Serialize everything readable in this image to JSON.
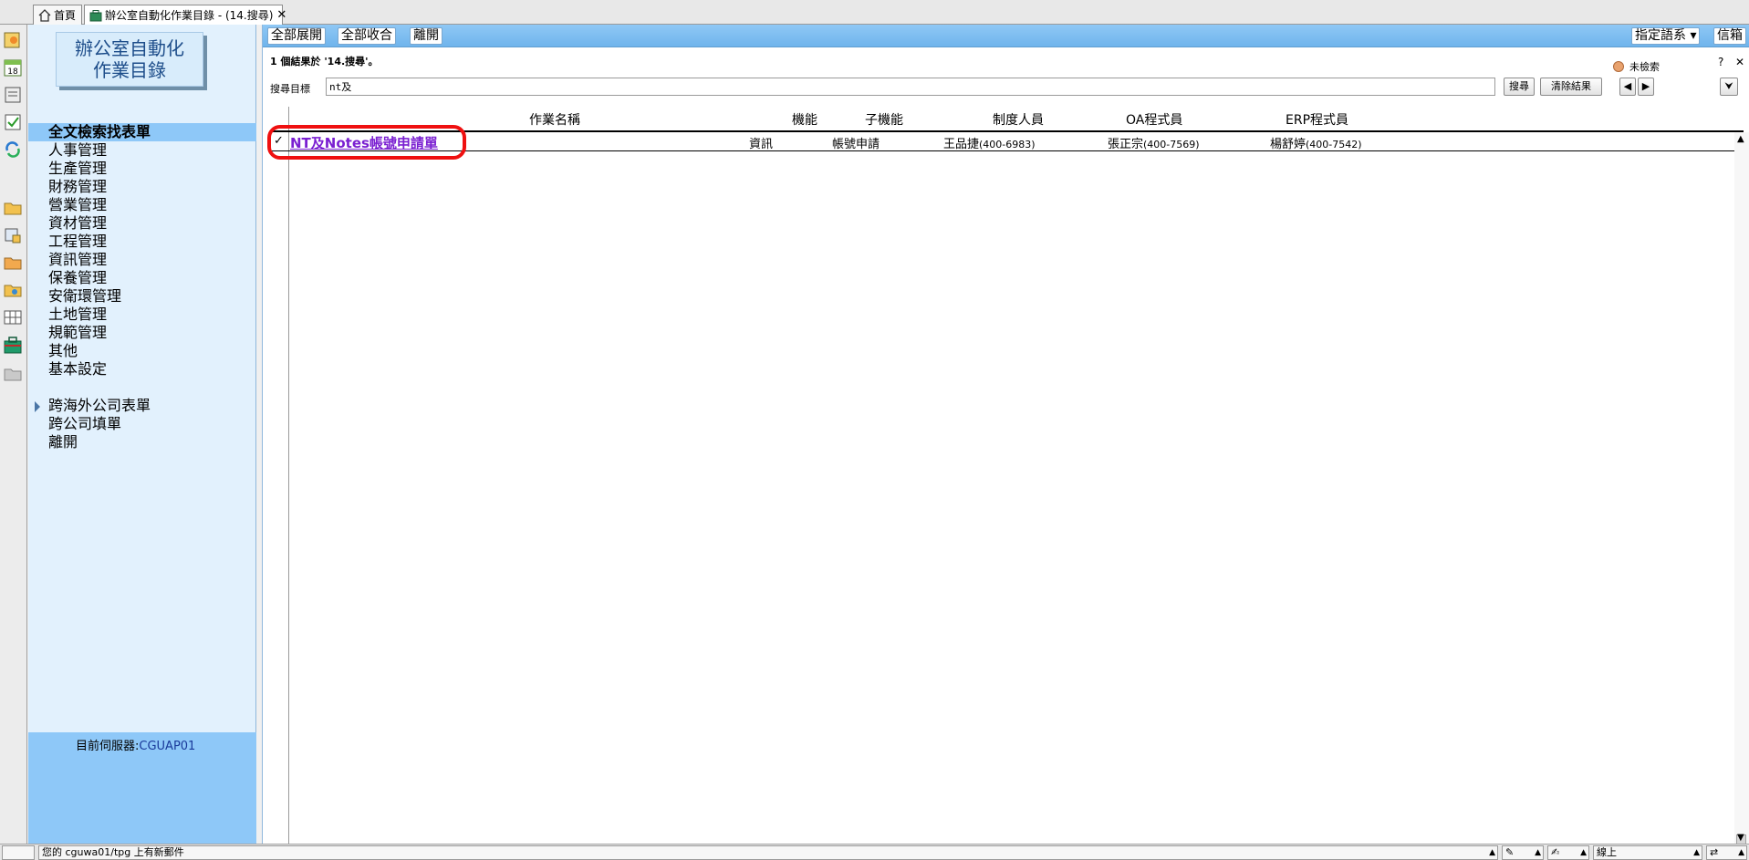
{
  "tabs": {
    "home_label": "首頁",
    "active_label": "辦公室自動化作業目錄 - (14.搜尋)",
    "close_glyph": "✕"
  },
  "sidebar": {
    "logo_line1": "辦公室自動化",
    "logo_line2": "作業目錄",
    "items": [
      "全文檢索找表單",
      "人事管理",
      "生產管理",
      "財務管理",
      "營業管理",
      "資材管理",
      "工程管理",
      "資訊管理",
      "保養管理",
      "安衛環管理",
      "土地管理",
      "規範管理",
      "其他",
      "基本設定"
    ],
    "items2": [
      "跨海外公司表單",
      "跨公司填單",
      "離開"
    ],
    "server_label": "目前伺服器:",
    "server_value": "CGUAP01"
  },
  "toolbar": {
    "expand_all": "全部展開",
    "collapse_all": "全部收合",
    "leave": "離開",
    "language": "指定語系",
    "mailbox": "信箱"
  },
  "search": {
    "result_summary": "1 個結果於 '14.搜尋'。",
    "status_text": "未檢索",
    "label": "搜尋目標",
    "value": "nt及",
    "search_button": "搜尋",
    "clear_button": "清除結果",
    "prev": "◀",
    "next": "▶",
    "expand": "⮟",
    "help": "?",
    "close": "✕"
  },
  "table": {
    "headers": [
      "作業名稱",
      "機能",
      "子機能",
      "制度人員",
      "OA程式員",
      "ERP程式員"
    ],
    "rows": [
      {
        "check": "✓",
        "name": "NT及Notes帳號申請單",
        "function": "資訊",
        "sub_function": "帳號申請",
        "owner": "王品捷",
        "owner_ext": "(400-6983)",
        "oa": "張正宗",
        "oa_ext": "(400-7569)",
        "erp": "楊舒婷",
        "erp_ext": "(400-7542)"
      }
    ]
  },
  "statusbar": {
    "message": "您的 cguwa01/tpg 上有新郵件",
    "network": "線上"
  },
  "colors": {
    "accent": "#8ec8f8",
    "sidebar_bg": "#e2f1fd",
    "link": "#7a1fd1",
    "highlight": "#ef1010"
  }
}
